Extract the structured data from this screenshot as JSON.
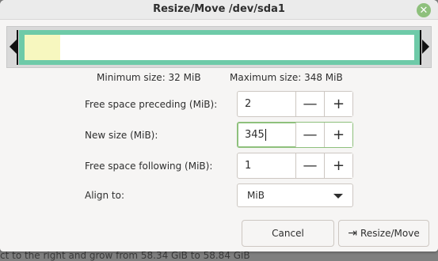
{
  "background": {
    "partial_text": "ct to the right and grow from 58.34 GiB to 58.84 GiB"
  },
  "dialog": {
    "title": "Resize/Move /dev/sda1",
    "close_icon": "close-icon",
    "accent_color": "#8ec07c",
    "partition_color": "#6ecaa8",
    "used_color": "#f7f7bf"
  },
  "partition_graphic": {
    "used_fraction": 0.09
  },
  "sizes": {
    "minimum": "Minimum size: 32 MiB",
    "maximum": "Maximum size: 348 MiB"
  },
  "fields": {
    "preceding": {
      "label": "Free space preceding (MiB):",
      "value": "2"
    },
    "new_size": {
      "label": "New size (MiB):",
      "value": "345"
    },
    "following": {
      "label": "Free space following (MiB):",
      "value": "1"
    },
    "align": {
      "label": "Align to:",
      "value": "MiB"
    }
  },
  "buttons": {
    "cancel": "Cancel",
    "resize": "Resize/Move",
    "resize_icon": "⇥"
  }
}
